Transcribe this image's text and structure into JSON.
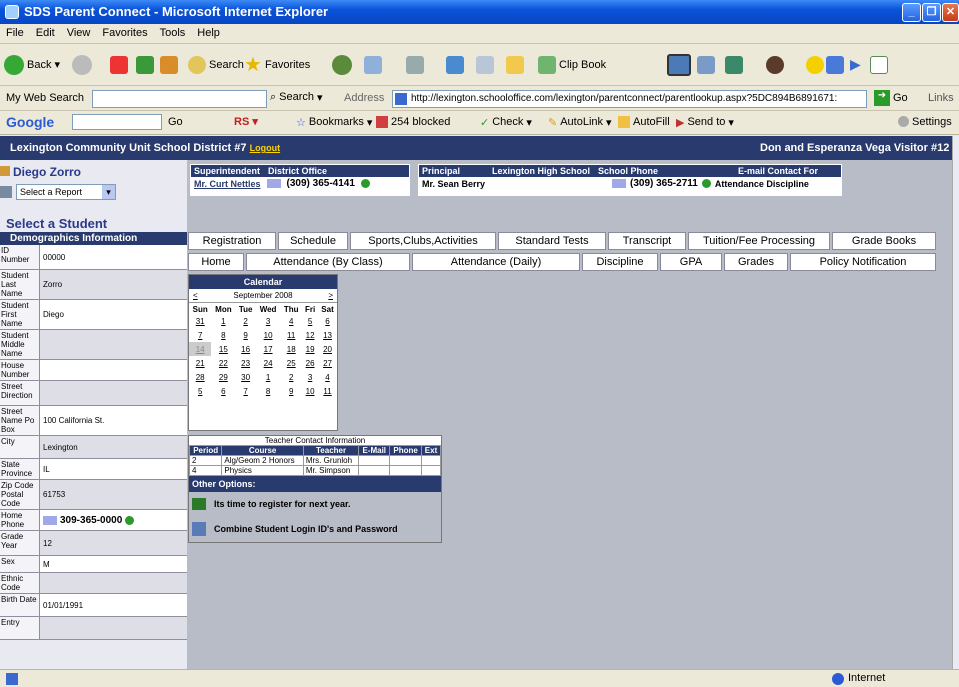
{
  "window": {
    "title": "SDS Parent Connect - Microsoft Internet Explorer"
  },
  "menu": [
    "File",
    "Edit",
    "View",
    "Favorites",
    "Tools",
    "Help"
  ],
  "toolbar": {
    "back": "Back",
    "search": "Search",
    "favorites": "Favorites",
    "clipbook": "Clip Book"
  },
  "address": {
    "websearch_label": "My Web Search",
    "search_btn": "Search",
    "label": "Address",
    "url": "http://lexington.schooloffice.com/lexington/parentconnect/parentlookup.aspx?5DC894B6891671:",
    "go": "Go",
    "links": "Links"
  },
  "googlebar": {
    "logo": "Google",
    "go": "Go",
    "bookmarks": "Bookmarks",
    "blocked": "254 blocked",
    "check": "Check",
    "autolink": "AutoLink",
    "autofill": "AutoFill",
    "sendto": "Send to",
    "settings": "Settings"
  },
  "banner": {
    "district": "Lexington Community Unit School District #7",
    "logout": "Logout",
    "visitor": "Don and Esperanza Vega   Visitor #12"
  },
  "student": {
    "name": "Diego Zorro",
    "report_select": "Select a Report"
  },
  "superintendent": {
    "h1": "Superintendent",
    "h2": "District Office",
    "name": "Mr. Curt Nettles",
    "phone": "(309) 365-4141"
  },
  "principal": {
    "h1": "Principal",
    "h2": "Lexington High School",
    "h3": "School Phone",
    "h4": "E-mail Contact For",
    "name": "Mr. Sean Berry",
    "phone": "(309) 365-2711",
    "contact": "Attendance Discipline"
  },
  "select_student": "Select a Student",
  "demographics": {
    "title": "Demographics Information",
    "rows": [
      {
        "label": "ID Number",
        "value": "00000"
      },
      {
        "label": "Student Last Name",
        "value": "Zorro"
      },
      {
        "label": "Student First Name",
        "value": "Diego"
      },
      {
        "label": "Student Middle Name",
        "value": ""
      },
      {
        "label": "House Number",
        "value": ""
      },
      {
        "label": "Street Direction",
        "value": ""
      },
      {
        "label": "Street Name Po Box",
        "value": "100 California St."
      },
      {
        "label": "City",
        "value": "Lexington"
      },
      {
        "label": "State Province",
        "value": "IL"
      },
      {
        "label": "Zip Code Postal Code",
        "value": "61753"
      },
      {
        "label": "Home Phone",
        "value": "309-365-0000"
      },
      {
        "label": "Grade Year",
        "value": "12"
      },
      {
        "label": "Sex",
        "value": "M"
      },
      {
        "label": "Ethnic Code",
        "value": ""
      },
      {
        "label": "Birth Date",
        "value": "01/01/1991"
      },
      {
        "label": "Entry",
        "value": ""
      }
    ]
  },
  "tabs_row1": [
    "Registration",
    "Schedule",
    "Sports,Clubs,Activities",
    "Standard Tests",
    "Transcript",
    "Tuition/Fee Processing",
    "Grade Books"
  ],
  "tabs_row2": [
    "Home",
    "Attendance (By Class)",
    "Attendance (Daily)",
    "Discipline",
    "GPA",
    "Grades",
    "Policy Notification"
  ],
  "calendar": {
    "title": "Calendar",
    "month": "September 2008",
    "prev": "<",
    "next": ">",
    "days": [
      "Sun",
      "Mon",
      "Tue",
      "Wed",
      "Thu",
      "Fri",
      "Sat"
    ],
    "weeks": [
      [
        "31",
        "1",
        "2",
        "3",
        "4",
        "5",
        "6"
      ],
      [
        "7",
        "8",
        "9",
        "10",
        "11",
        "12",
        "13"
      ],
      [
        "14",
        "15",
        "16",
        "17",
        "18",
        "19",
        "20"
      ],
      [
        "21",
        "22",
        "23",
        "24",
        "25",
        "26",
        "27"
      ],
      [
        "28",
        "29",
        "30",
        "1",
        "2",
        "3",
        "4"
      ],
      [
        "5",
        "6",
        "7",
        "8",
        "9",
        "10",
        "11"
      ]
    ],
    "today": "14"
  },
  "teacher_info": {
    "title": "Teacher Contact Information",
    "headers": [
      "Period",
      "Course",
      "Teacher",
      "E-Mail",
      "Phone",
      "Ext"
    ],
    "rows": [
      [
        "2",
        "Alg/Geom 2 Honors",
        "Mrs. Grunloh",
        "",
        "",
        ""
      ],
      [
        "4",
        "Physics",
        "Mr. Simpson",
        "",
        "",
        ""
      ]
    ]
  },
  "other_options": {
    "title": "Other Options:",
    "opt1": "Its time to register for next year.",
    "opt2": "Combine Student Login ID's and Password"
  },
  "status": {
    "zone": "Internet"
  }
}
